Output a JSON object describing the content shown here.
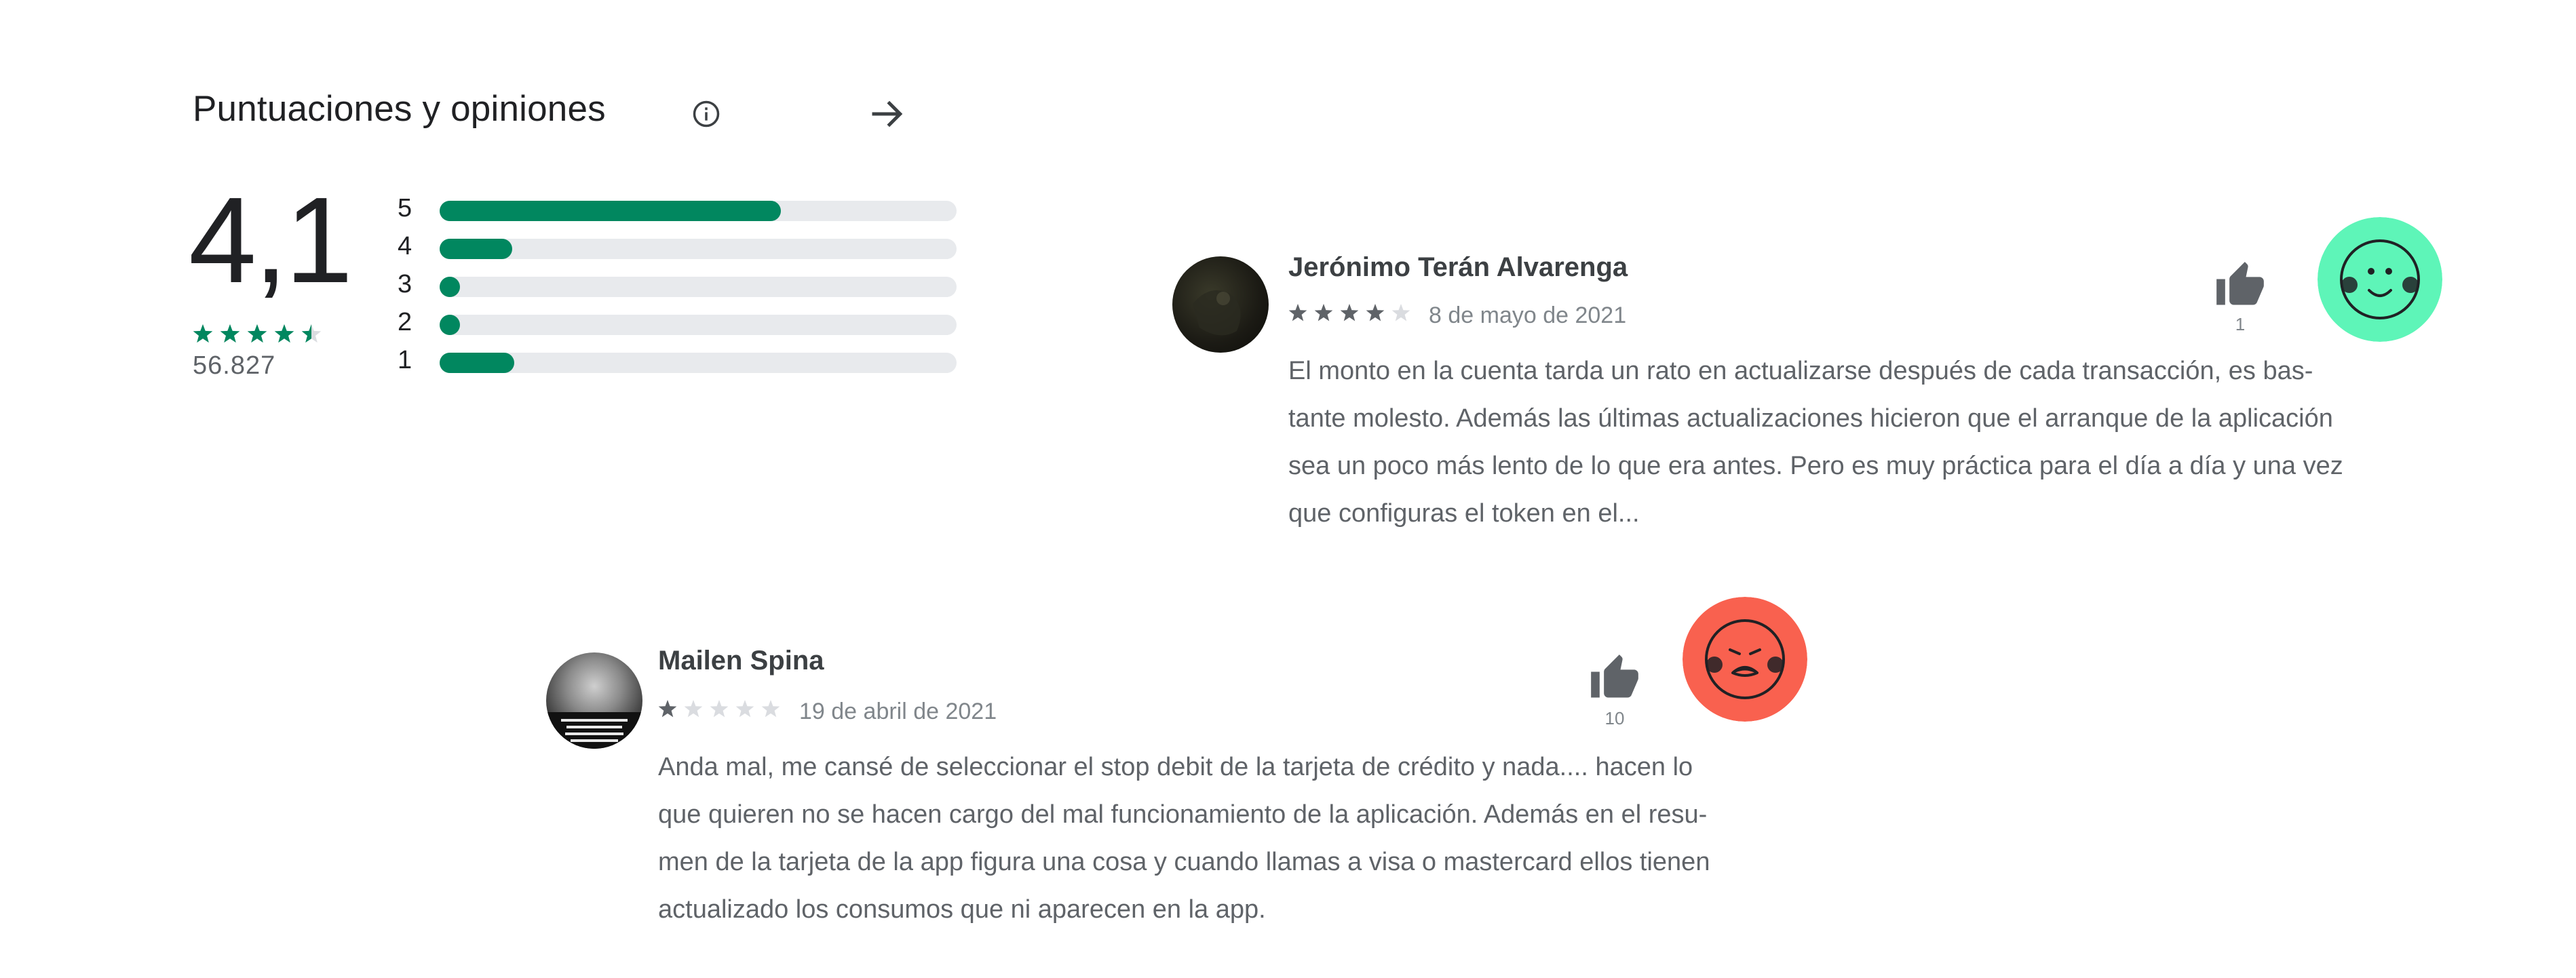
{
  "header": {
    "title": "Puntuaciones y opiniones",
    "info_icon": "info-icon",
    "arrow_icon": "arrow-right-icon"
  },
  "summary": {
    "average": "4,1",
    "stars_value": 4.5,
    "count": "56.827",
    "histogram": [
      {
        "label": "5",
        "fraction": 0.66
      },
      {
        "label": "4",
        "fraction": 0.14
      },
      {
        "label": "3",
        "fraction": 0.0
      },
      {
        "label": "2",
        "fraction": 0.0
      },
      {
        "label": "1",
        "fraction": 0.145
      }
    ]
  },
  "reviews": [
    {
      "name": "Jerónimo Terán Alvarenga",
      "rating": 4,
      "date": "8 de mayo de 2021",
      "helpful_count": "1",
      "lines": [
        "El monto en la cuenta tarda un rato en actualizarse después de cada transacción, es bas-",
        "tante molesto. Además las últimas actualizaciones hicieron que el arranque de la aplicación",
        "sea un poco más lento de lo que era antes. Pero es muy práctica para el día a día y una vez",
        "que configuras el token en el..."
      ],
      "sentiment": "happy-face-icon",
      "sentiment_color": "#5ef5b8"
    },
    {
      "name": "Mailen Spina",
      "rating": 1,
      "date": "19 de abril de 2021",
      "helpful_count": "10",
      "lines": [
        "Anda mal, me cansé de seleccionar el stop debit de la tarjeta de crédito y nada.... hacen lo",
        "que quieren no se hacen cargo del mal funcionamiento de la aplicación. Además en el resu-",
        "men de la tarjeta de la app figura una cosa y cuando llamas a visa o mastercard ellos tienen",
        "actualizado los consumos que ni aparecen en la app."
      ],
      "sentiment": "sad-face-icon",
      "sentiment_color": "#f9614f"
    }
  ],
  "colors": {
    "accent": "#01875f",
    "track": "#e8eaed",
    "text": "#202124",
    "muted": "#5f6368"
  }
}
